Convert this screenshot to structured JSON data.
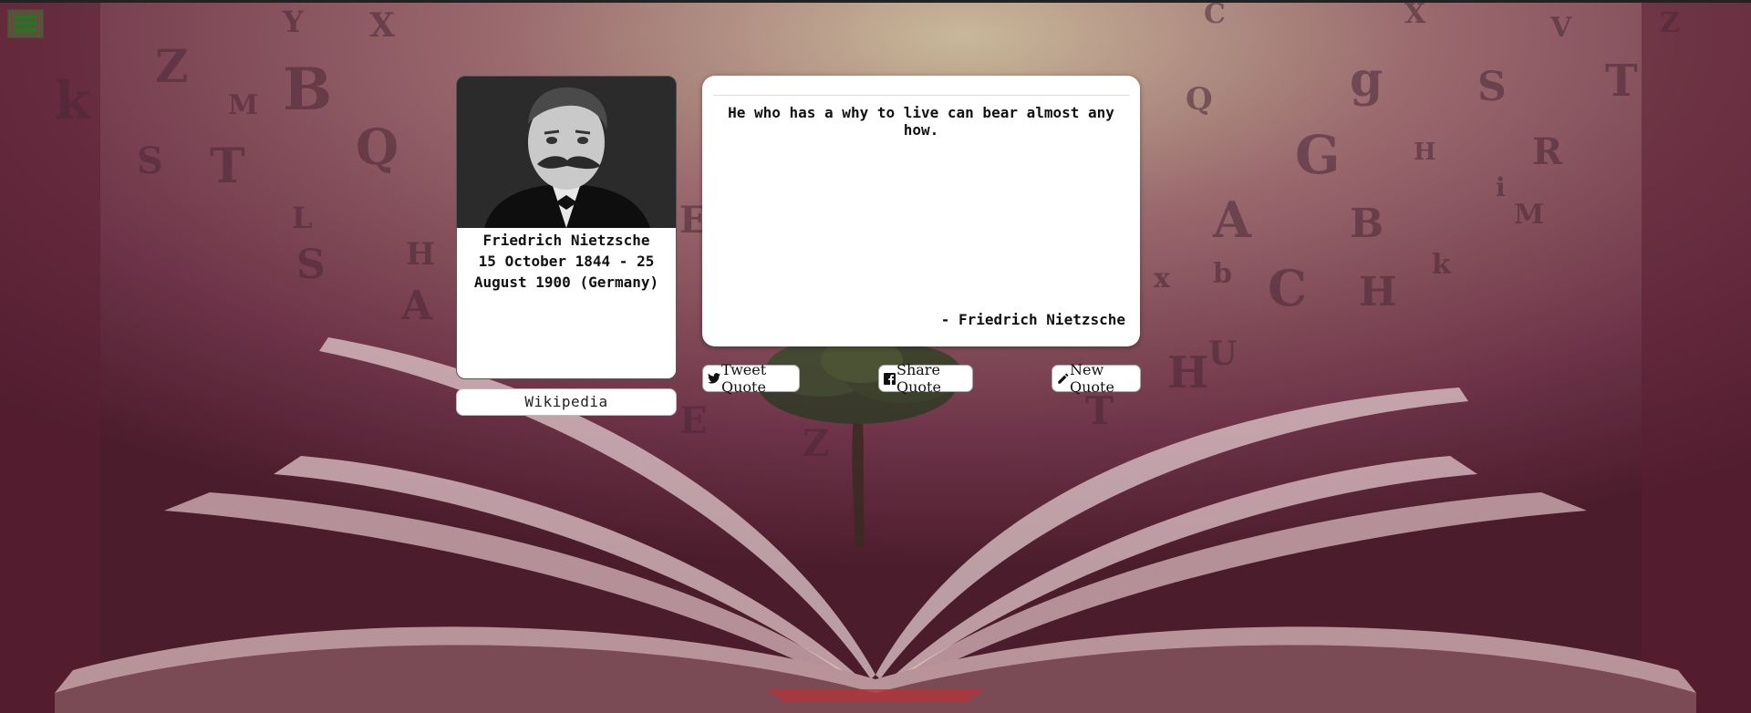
{
  "menu": {
    "icon": "hamburger-menu-icon",
    "color": "#1f7a1f"
  },
  "author": {
    "name": "Friedrich Nietzsche",
    "dates_line1": "15 October 1844 - 25",
    "dates_line2": "August 1900 (Germany)",
    "portrait": "author-portrait"
  },
  "links": {
    "wikipedia_label": "Wikipedia"
  },
  "quote": {
    "text": "He who has a why to live can bear almost any how.",
    "attribution": "- Friedrich Nietzsche"
  },
  "actions": {
    "tweet_label": "Tweet Quote",
    "tweet_icon": "twitter-icon",
    "share_label": "Share Quote",
    "share_icon": "facebook-icon",
    "new_label": "New Quote",
    "new_icon": "pencil-icon"
  },
  "background": {
    "description_icon": "open-book-background",
    "tint": "#6b2f45"
  }
}
